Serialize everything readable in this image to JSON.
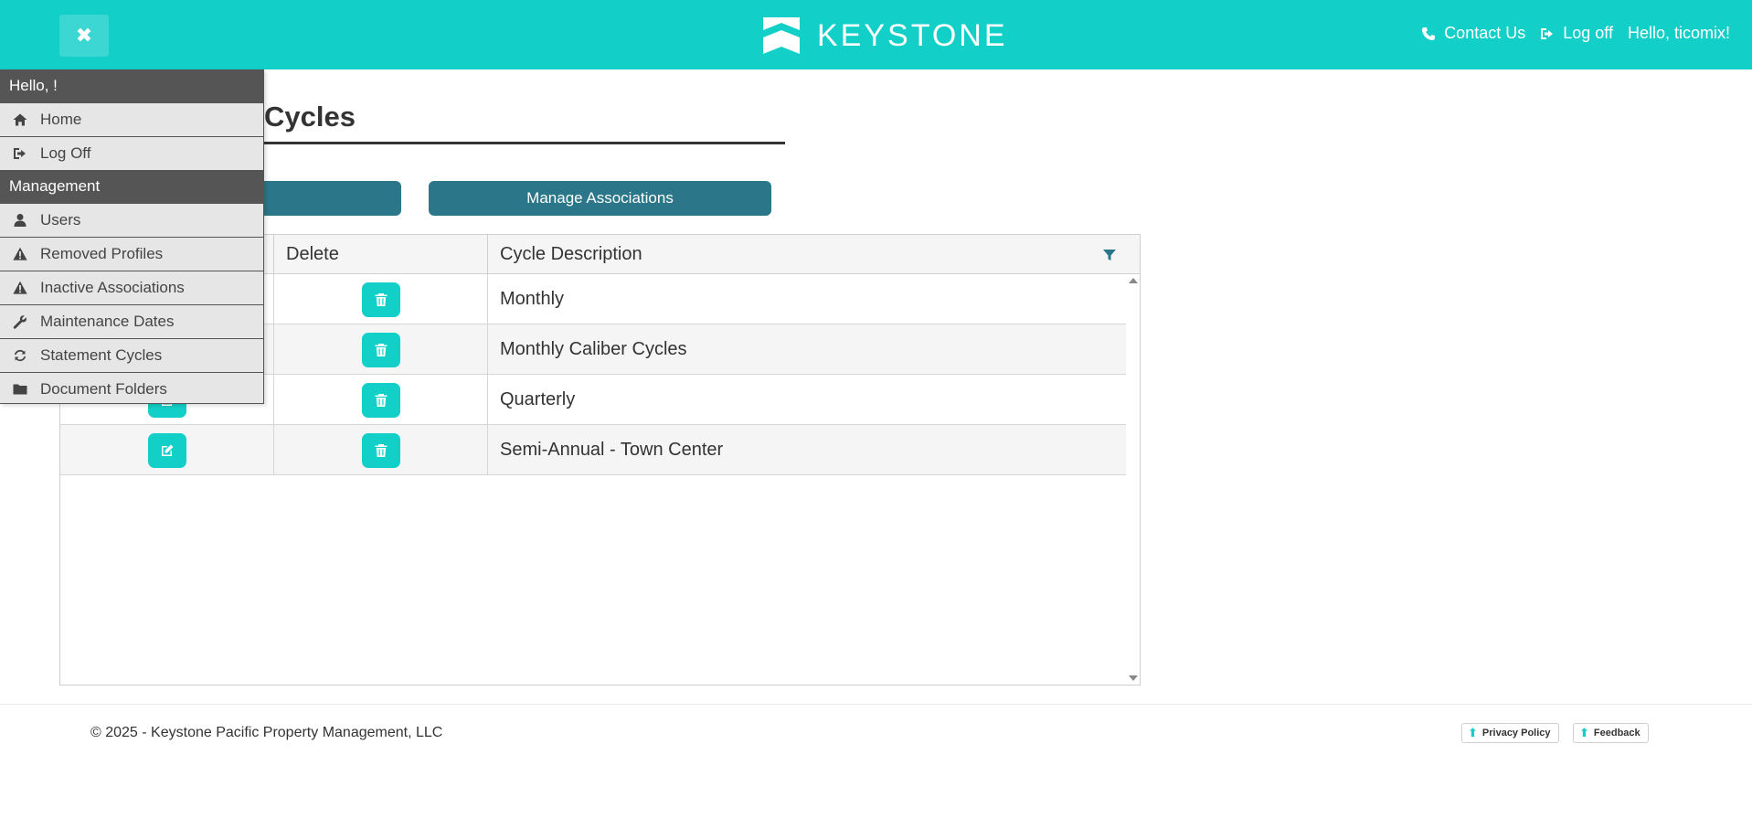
{
  "header": {
    "brand": "KEYSTONE",
    "links": [
      {
        "label": "Contact Us",
        "icon": "phone-icon"
      },
      {
        "label": "Log off",
        "icon": "sign-out-icon"
      }
    ],
    "greeting": "Hello, ticomix!",
    "bg_color": "#12cfc8"
  },
  "page": {
    "title_visible": "Cycles",
    "manage_button": "Manage Associations"
  },
  "grid": {
    "columns": [
      "Delete",
      "Cycle Description"
    ],
    "rows": [
      {
        "description": "Monthly"
      },
      {
        "description": "Monthly Caliber Cycles"
      },
      {
        "description": "Quarterly"
      },
      {
        "description": "Semi-Annual - Town Center"
      }
    ]
  },
  "side_menu": {
    "greeting": "Hello, !",
    "top_items": [
      {
        "label": "Home",
        "icon": "home-icon"
      },
      {
        "label": "Log Off",
        "icon": "sign-out-icon"
      }
    ],
    "section": "Management",
    "management_items": [
      {
        "label": "Users",
        "icon": "user-icon"
      },
      {
        "label": "Removed Profiles",
        "icon": "warning-icon"
      },
      {
        "label": "Inactive Associations",
        "icon": "warning-icon"
      },
      {
        "label": "Maintenance Dates",
        "icon": "wrench-icon"
      },
      {
        "label": "Statement Cycles",
        "icon": "refresh-icon"
      },
      {
        "label": "Document Folders",
        "icon": "folder-icon"
      }
    ]
  },
  "footer": {
    "copyright": "© 2025 - Keystone Pacific Property Management, LLC",
    "privacy": "Privacy Policy",
    "feedback": "Feedback"
  }
}
